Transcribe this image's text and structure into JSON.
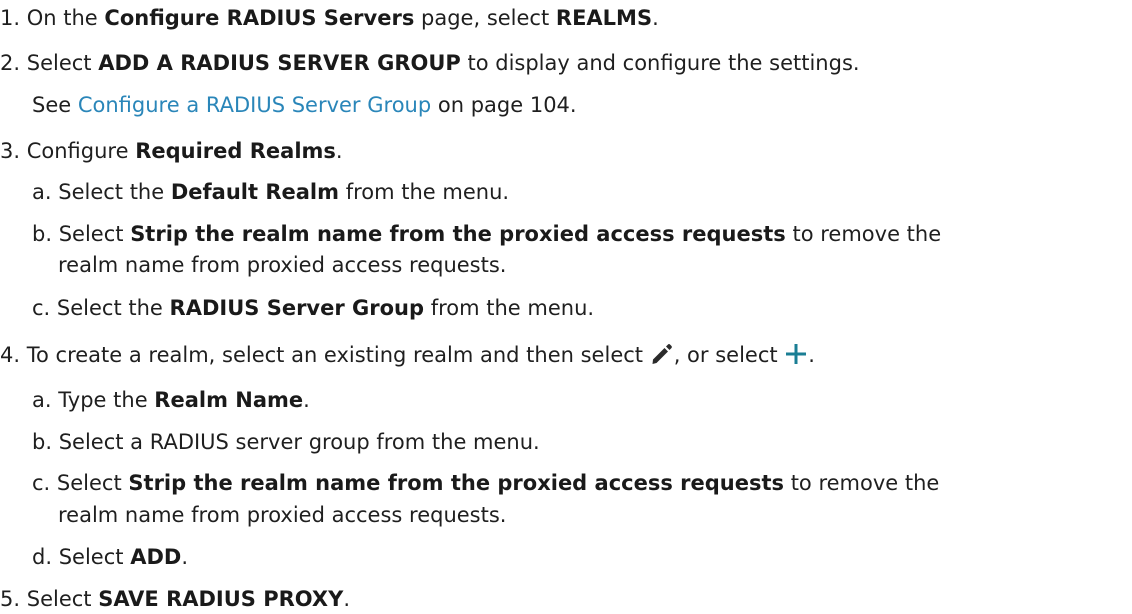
{
  "steps": {
    "s1": {
      "num": "1.",
      "pre": "On the",
      "b1": "Configure RADIUS Servers",
      "mid": "page, select",
      "b2": "REALMS",
      "post": "."
    },
    "s2": {
      "num": "2.",
      "pre": "Select",
      "b1": "ADD A RADIUS SERVER GROUP",
      "post": "to display and configure the settings.",
      "see_pre": "See",
      "see_link": "Configure a RADIUS Server Group",
      "see_post": "on page 104."
    },
    "s3": {
      "num": "3.",
      "pre": "Configure",
      "b1": "Required Realms",
      "post": ".",
      "a": {
        "letter": "a.",
        "pre": "Select the",
        "b1": "Default Realm",
        "post": "from the menu."
      },
      "b": {
        "letter": "b.",
        "pre": "Select",
        "b1": "Strip the realm name from the proxied access requests",
        "post": "to remove the",
        "cont": "realm name from proxied access requests."
      },
      "c": {
        "letter": "c.",
        "pre": "Select the",
        "b1": "RADIUS Server Group",
        "post": "from the menu."
      }
    },
    "s4": {
      "num": "4.",
      "pre": "To create a realm, select an existing realm and then select",
      "mid": ", or select",
      "post": ".",
      "edit_icon": "pencil-icon",
      "add_icon": "plus-icon",
      "add_icon_color": "#1a7e94",
      "a": {
        "letter": "a.",
        "pre": "Type the",
        "b1": "Realm Name",
        "post": "."
      },
      "b": {
        "letter": "b.",
        "text": "Select a RADIUS server group from the menu."
      },
      "c": {
        "letter": "c.",
        "pre": "Select",
        "b1": "Strip the realm name from the proxied access requests",
        "post": "to remove the",
        "cont": "realm name from proxied access requests."
      },
      "d": {
        "letter": "d.",
        "pre": "Select",
        "b1": "ADD",
        "post": "."
      }
    },
    "s5": {
      "num": "5.",
      "pre": "Select",
      "b1": "SAVE RADIUS PROXY",
      "post": "."
    }
  }
}
